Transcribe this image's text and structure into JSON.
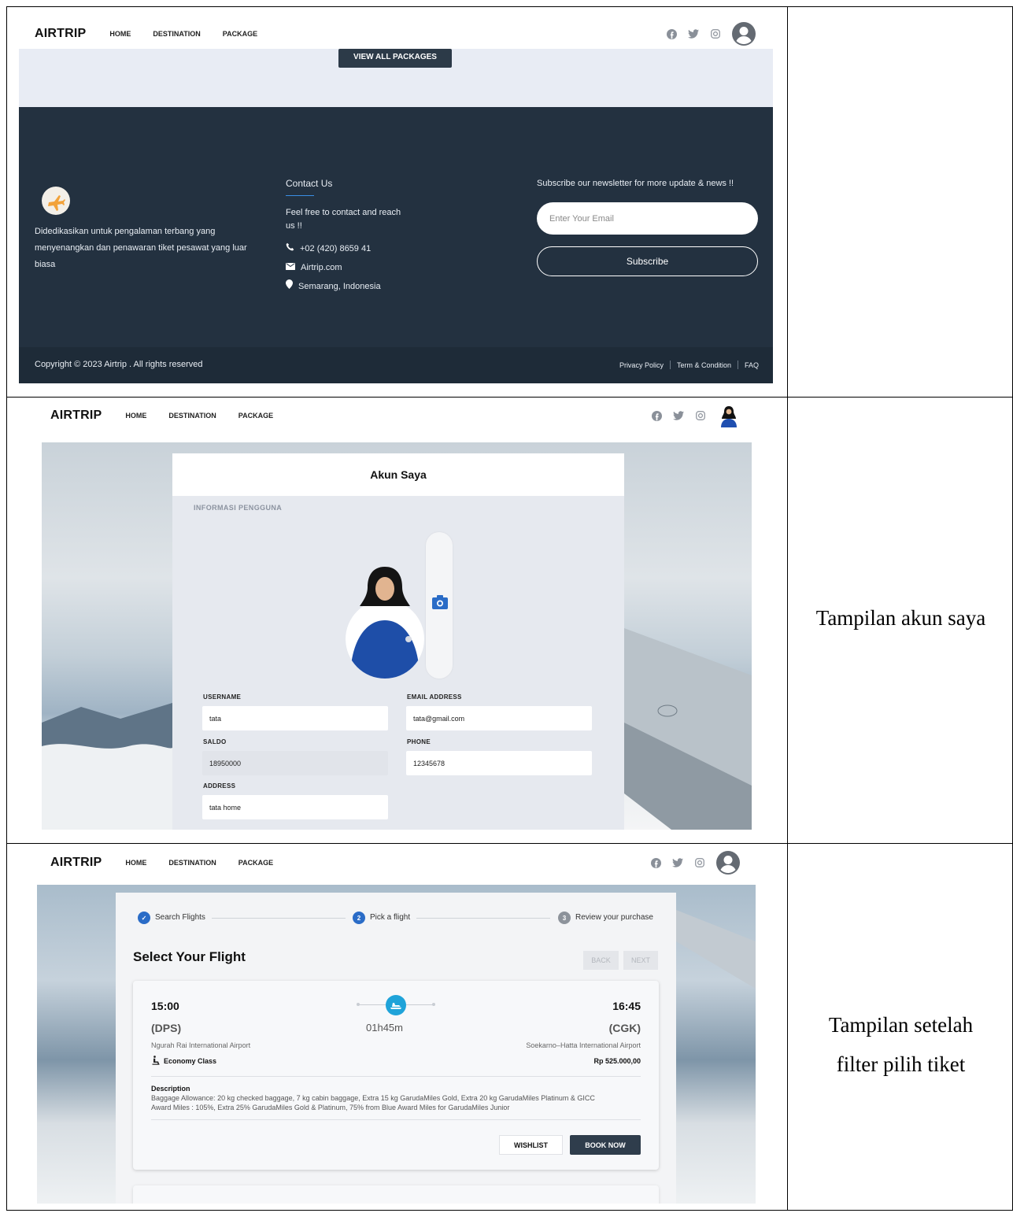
{
  "captions": {
    "row2": "Tampilan akun saya",
    "row3_line1": "Tampilan setelah",
    "row3_line2": "filter pilih tiket"
  },
  "nav": {
    "brand": "AIRTRIP",
    "links": [
      "HOME",
      "DESTINATION",
      "PACKAGE"
    ]
  },
  "panel1": {
    "view_all_label": "VIEW ALL PACKAGES",
    "about_text_1": "Didedikasikan untuk pengalaman terbang yang",
    "about_text_2": "menyenangkan dan penawaran tiket pesawat yang luar",
    "about_text_3": "biasa",
    "contact_title": "Contact Us",
    "contact_sub_1": "Feel free to contact and reach",
    "contact_sub_2": "us !!",
    "phone": "+02 (420) 8659 41",
    "email": "Airtrip.com",
    "location": "Semarang, Indonesia",
    "newsletter_title": "Subscribe our newsletter for more update & news !!",
    "email_placeholder": "Enter Your Email",
    "subscribe_label": "Subscribe",
    "copyright": "Copyright © 2023 Airtrip . All rights reserved",
    "links": [
      "Privacy Policy",
      "Term & Condition",
      "FAQ"
    ]
  },
  "panel2": {
    "title": "Akun Saya",
    "section": "INFORMASI PENGGUNA",
    "fields": {
      "username_label": "USERNAME",
      "username": "tata",
      "email_label": "EMAIL ADDRESS",
      "email": "tata@gmail.com",
      "saldo_label": "SALDO",
      "saldo": "18950000",
      "phone_label": "PHONE",
      "phone": "12345678",
      "address_label": "ADDRESS",
      "address": "tata home"
    }
  },
  "panel3": {
    "steps": [
      {
        "num": "✓",
        "label": "Search Flights"
      },
      {
        "num": "2",
        "label": "Pick a flight"
      },
      {
        "num": "3",
        "label": "Review your purchase"
      }
    ],
    "title": "Select Your Flight",
    "back_label": "BACK",
    "next_label": "NEXT",
    "flight": {
      "depart_time": "15:00",
      "arrive_time": "16:45",
      "depart_code": "(DPS)",
      "arrive_code": "(CGK)",
      "duration": "01h45m",
      "depart_airport": "Ngurah Rai International Airport",
      "arrive_airport": "Soekarno–Hatta International Airport",
      "class": "Economy Class",
      "price": "Rp 525.000,00",
      "desc_title": "Description",
      "desc_1": "Baggage Allowance: 20 kg checked baggage, 7 kg cabin baggage, Extra 15 kg GarudaMiles Gold, Extra 20 kg GarudaMiles Platinum & GICC",
      "desc_2": "Award Miles : 105%, Extra 25% GarudaMiles Gold & Platinum, 75% from Blue Award Miles for GarudaMiles Junior",
      "wishlist_label": "WISHLIST",
      "book_label": "BOOK NOW"
    }
  }
}
